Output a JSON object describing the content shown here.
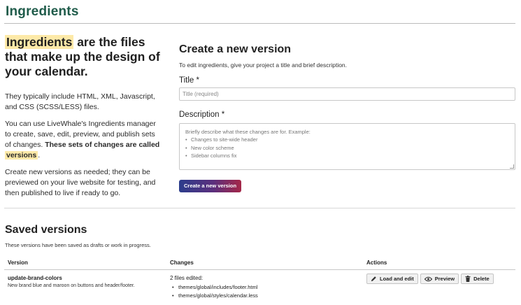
{
  "header": {
    "title": "Ingredients"
  },
  "intro": {
    "heading_highlight": "Ingredients",
    "heading_rest": " are the files that make up the design of your calendar.",
    "p1": "They typically include HTML, XML, Javascript, and CSS (SCSS/LESS) files.",
    "p2_text": "You can use LiveWhale's Ingredients manager to create, save, edit, preview, and publish sets of changes. ",
    "p2_bold": "These sets of changes are called ",
    "p2_highlight": "versions",
    "p2_end": ".",
    "p3": "Create new versions as needed; they can be previewed on your live website for testing, and then published to live if ready to go."
  },
  "form": {
    "title": "Create a new version",
    "help": "To edit ingredients, give your project a title and brief description.",
    "title_label": "Title *",
    "title_placeholder": "Title (required)",
    "description_label": "Description *",
    "description_intro": "Briefly describe what these changes are for. Example:",
    "description_examples": [
      "Changes to site-wide header",
      "New color scheme",
      "Sidebar columns fix"
    ],
    "submit_label": "Create a new version"
  },
  "saved": {
    "title": "Saved versions",
    "help": "These versions have been saved as drafts or work in progress.",
    "columns": {
      "version": "Version",
      "changes": "Changes",
      "actions": "Actions"
    },
    "rows": [
      {
        "name": "update-brand-colors",
        "description": "New brand blue and maroon on buttons and header/footer.",
        "changes_count": "2 files edited:",
        "files": [
          "themes/global/includes/footer.html",
          "themes/global/styles/calendar.less"
        ],
        "actions": {
          "load_edit": "Load and edit",
          "preview": "Preview",
          "delete": "Delete"
        }
      }
    ]
  },
  "colors": {
    "brand_green": "#1f5b4a",
    "highlight": "#fde9a8",
    "button_start": "#2c3d8c",
    "button_end": "#a52748"
  },
  "icons": {
    "load_edit": "pencil-icon",
    "preview": "eye-icon",
    "delete": "trash-icon"
  }
}
